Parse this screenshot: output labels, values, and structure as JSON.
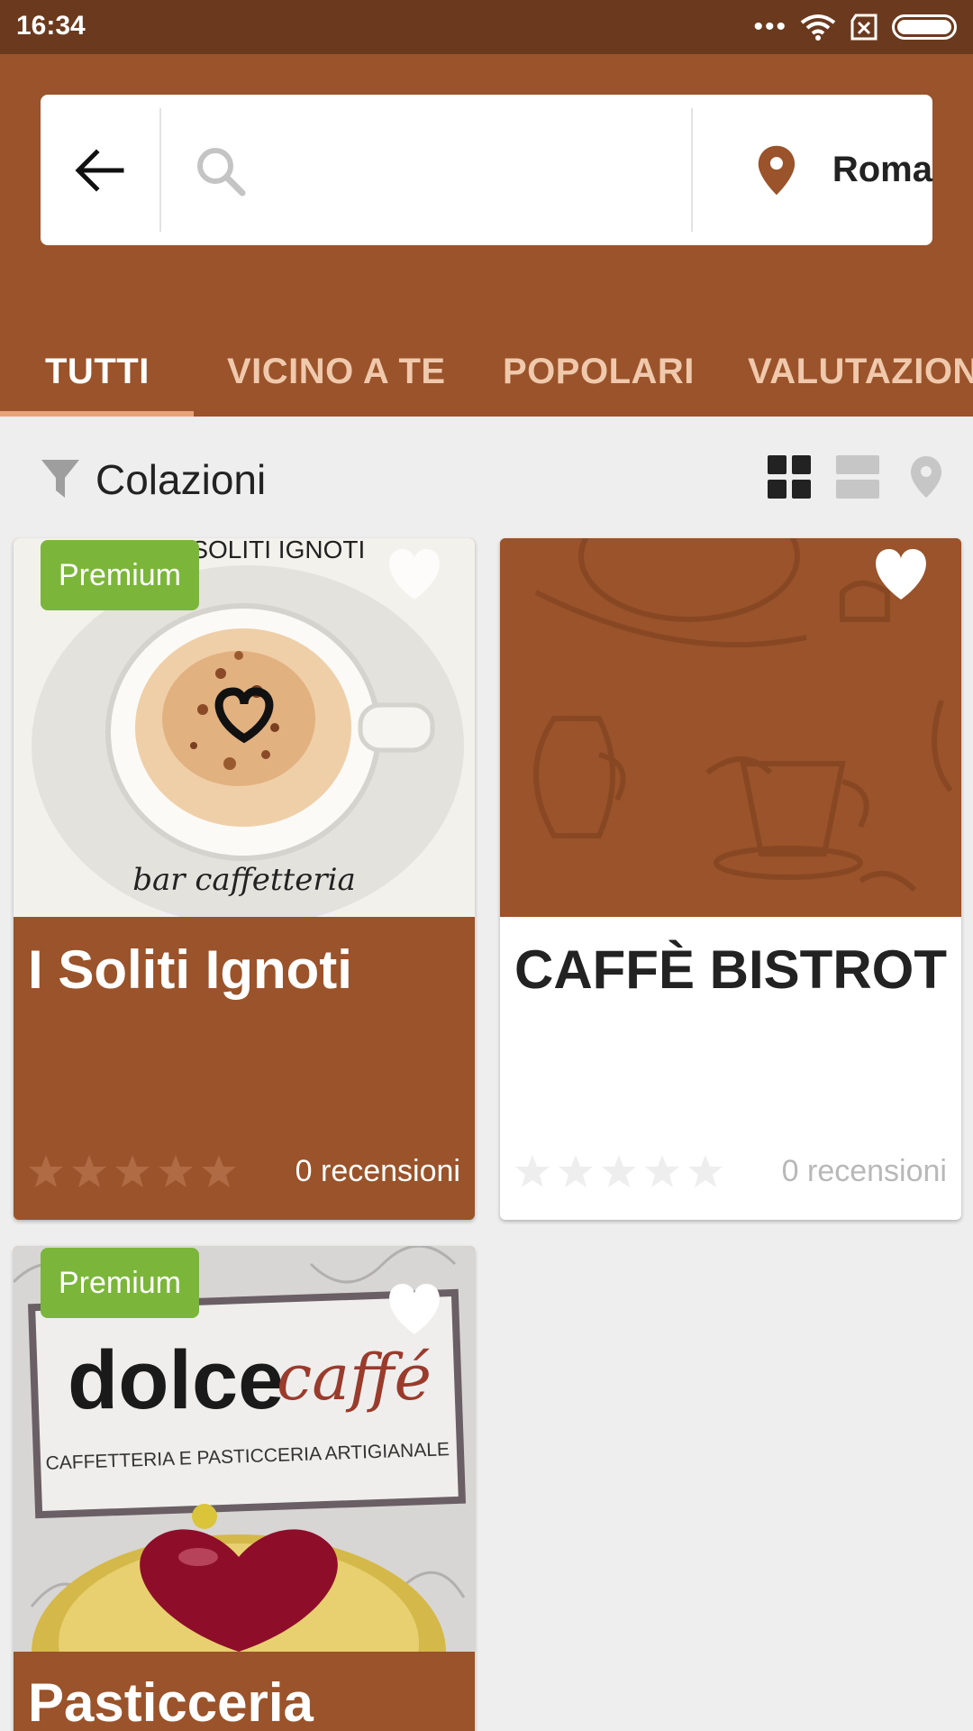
{
  "status_bar": {
    "time": "16:34",
    "icons": [
      "more-dots-icon",
      "wifi-icon",
      "no-sim-icon",
      "battery-icon"
    ]
  },
  "search": {
    "placeholder": "",
    "value": "",
    "location": "Roma"
  },
  "tabs": [
    {
      "label": "TUTTI",
      "active": true
    },
    {
      "label": "VICINO A TE",
      "active": false
    },
    {
      "label": "POPOLARI",
      "active": false
    },
    {
      "label": "VALUTAZIONI",
      "active": false
    }
  ],
  "filter": {
    "label": "Colazioni",
    "view_mode": "grid"
  },
  "cards": [
    {
      "title": "I Soliti Ignoti",
      "premium": true,
      "badge": "Premium",
      "reviews": "0 recensioni",
      "rating": 0,
      "image_caption": "bar caffetteria",
      "image_sign": "I SOLITI IGNOTI"
    },
    {
      "title": "CAFFÈ BISTROT",
      "premium": false,
      "badge": "",
      "reviews": "0 recensioni",
      "rating": 0
    },
    {
      "title": "Pasticceria",
      "premium": true,
      "badge": "Premium",
      "reviews": "",
      "rating": 0,
      "image_logo_a": "dolce",
      "image_logo_b": "caffé",
      "image_subtitle": "CAFFETTERIA E PASTICCERIA ARTIGIANALE"
    }
  ],
  "colors": {
    "brand": "#9a532a",
    "status_bar": "#6b3a1e",
    "premium": "#7bb63a",
    "tab_inactive": "#f0c9ad"
  }
}
